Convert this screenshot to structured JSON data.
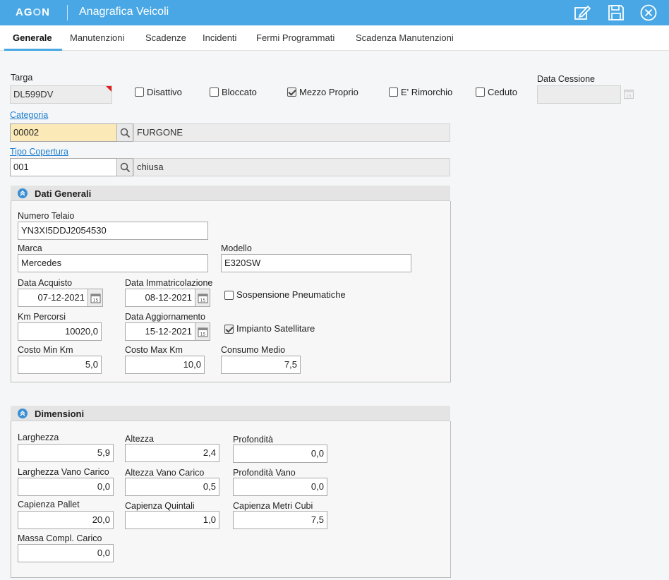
{
  "header": {
    "logo_prefix": "AG",
    "logo_o": "O",
    "logo_suffix": "N",
    "title": "Anagrafica Veicoli",
    "icons": [
      "edit-icon",
      "save-icon",
      "close-icon"
    ]
  },
  "tabs": [
    {
      "label": "Generale"
    },
    {
      "label": "Manutenzioni"
    },
    {
      "label": "Scadenze"
    },
    {
      "label": "Incidenti"
    },
    {
      "label": "Fermi Programmati"
    },
    {
      "label": "Scadenza Manutenzioni"
    }
  ],
  "general": {
    "targa_label": "Targa",
    "targa_value": "DL599DV",
    "checkboxes": [
      {
        "label": "Disattivo",
        "checked": false
      },
      {
        "label": "Bloccato",
        "checked": false
      },
      {
        "label": "Mezzo Proprio",
        "checked": true
      },
      {
        "label": "E' Rimorchio",
        "checked": false
      },
      {
        "label": "Ceduto",
        "checked": false
      }
    ],
    "data_cessione_label": "Data Cessione",
    "data_cessione_value": "",
    "categoria_label": "Categoria",
    "categoria_code": "00002",
    "categoria_desc": "FURGONE",
    "tipo_copertura_label": "Tipo Copertura",
    "tipo_copertura_code": "001",
    "tipo_copertura_desc": "chiusa"
  },
  "dati_generali": {
    "title": "Dati Generali",
    "numero_telaio_label": "Numero Telaio",
    "numero_telaio_value": "YN3XI5DDJ2054530",
    "marca_label": "Marca",
    "marca_value": "Mercedes",
    "modello_label": "Modello",
    "modello_value": "E320SW",
    "data_acquisto_label": "Data Acquisto",
    "data_acquisto_value": "07-12-2021",
    "data_immatricolazione_label": "Data Immatricolazione",
    "data_immatricolazione_value": "08-12-2021",
    "sospensione_label": "Sospensione Pneumatiche",
    "sospensione_checked": false,
    "km_percorsi_label": "Km Percorsi",
    "km_percorsi_value": "10020,0",
    "data_aggiornamento_label": "Data Aggiornamento",
    "data_aggiornamento_value": "15-12-2021",
    "impianto_label": "Impianto Satellitare",
    "impianto_checked": true,
    "costo_min_label": "Costo Min Km",
    "costo_min_value": "5,0",
    "costo_max_label": "Costo Max Km",
    "costo_max_value": "10,0",
    "consumo_label": "Consumo Medio",
    "consumo_value": "7,5"
  },
  "dimensioni": {
    "title": "Dimensioni",
    "larghezza_label": "Larghezza",
    "larghezza_value": "5,9",
    "altezza_label": "Altezza",
    "altezza_value": "2,4",
    "profondita_label": "Profondità",
    "profondita_value": "0,0",
    "larghezza_vano_label": "Larghezza Vano Carico",
    "larghezza_vano_value": "0,0",
    "altezza_vano_label": "Altezza Vano Carico",
    "altezza_vano_value": "0,5",
    "profondita_vano_label": "Profondità Vano",
    "profondita_vano_value": "0,0",
    "capienza_pallet_label": "Capienza Pallet",
    "capienza_pallet_value": "20,0",
    "capienza_quintali_label": "Capienza Quintali",
    "capienza_quintali_value": "1,0",
    "capienza_metri_label": "Capienza Metri Cubi",
    "capienza_metri_value": "7,5",
    "massa_label": "Massa Compl. Carico",
    "massa_value": "0,0"
  }
}
